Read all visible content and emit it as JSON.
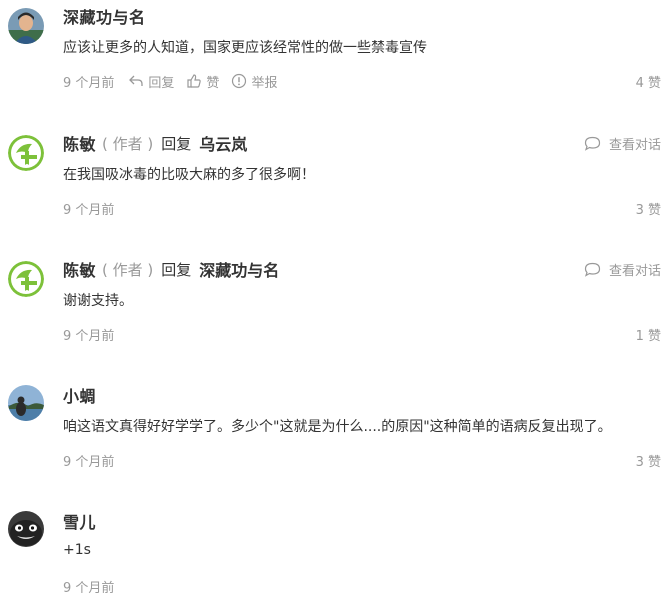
{
  "comments": [
    {
      "name": "深藏功与名",
      "text": "应该让更多的人知道，国家更应该经常性的做一些禁毒宣传",
      "time": "9 个月前",
      "reply_label": "回复",
      "like_label": "赞",
      "report_label": "举报",
      "likes": "4 赞",
      "avatar": "photo-portrait"
    },
    {
      "name": "陈敏",
      "author_tag": "( 作者 )",
      "reply_word": "回复",
      "reply_to": "乌云岚",
      "view_dialog": "查看对话",
      "text": "在我国吸冰毒的比吸大麻的多了很多啊！",
      "time": "9 个月前",
      "likes": "3 赞",
      "avatar": "green-logo"
    },
    {
      "name": "陈敏",
      "author_tag": "( 作者 )",
      "reply_word": "回复",
      "reply_to": "深藏功与名",
      "view_dialog": "查看对话",
      "text": "谢谢支持。",
      "time": "9 个月前",
      "likes": "1 赞",
      "avatar": "green-logo"
    },
    {
      "name": "小蜩",
      "text": "咱这语文真得好好学学了。多少个\"这就是为什么....的原因\"这种简单的语病反复出现了。",
      "time": "9 个月前",
      "likes": "3 赞",
      "avatar": "photo-landscape"
    },
    {
      "name": "雪儿",
      "text": "+1s",
      "time": "9 个月前",
      "avatar": "dark-cartoon"
    }
  ],
  "colors": {
    "muted": "#999999",
    "text": "#333333",
    "logo_green": "#7dc13a"
  }
}
